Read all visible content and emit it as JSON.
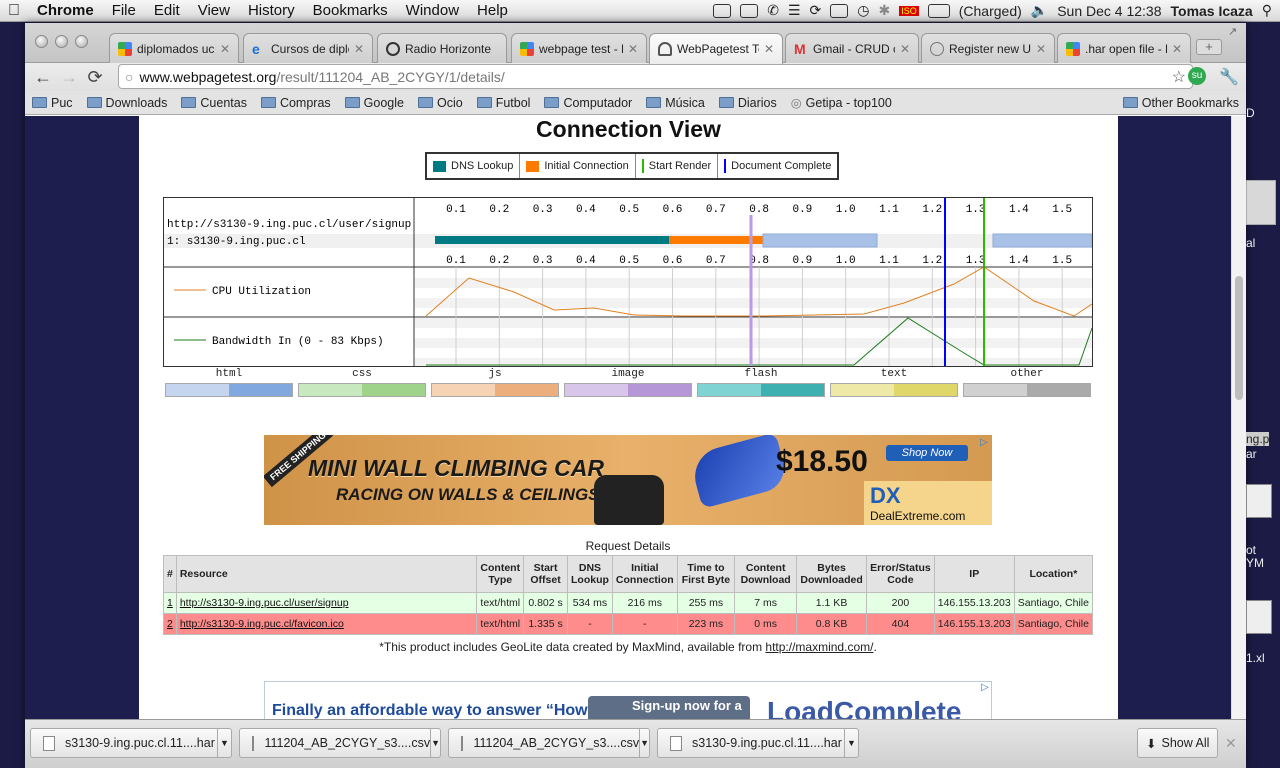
{
  "menubar": {
    "app": "Chrome",
    "items": [
      "File",
      "Edit",
      "View",
      "History",
      "Bookmarks",
      "Window",
      "Help"
    ],
    "battery": "(Charged)",
    "datetime": "Sun Dec 4  12:38",
    "user": "Tomas Icaza"
  },
  "tabs": [
    {
      "label": "diplomados uc",
      "favicon": "google"
    },
    {
      "label": "Cursos de diplom",
      "favicon": "ie"
    },
    {
      "label": "Radio Horizonte",
      "favicon": "radio"
    },
    {
      "label": "webpage test - E",
      "favicon": "google"
    },
    {
      "label": "WebPagetest Tes",
      "favicon": "speedometer",
      "active": true
    },
    {
      "label": "Gmail - CRUD co",
      "favicon": "gmail"
    },
    {
      "label": "Register new Use",
      "favicon": "globe"
    },
    {
      "label": ".har open file - E",
      "favicon": "google"
    }
  ],
  "url": {
    "host": "www.webpagetest.org",
    "path": "/result/111204_AB_2CYGY/1/details/"
  },
  "bookmarks": [
    "Puc",
    "Downloads",
    "Cuentas",
    "Compras",
    "Google",
    "Ocio",
    "Futbol",
    "Computador",
    "Música",
    "Diarios"
  ],
  "bookmark_getipa": "Getipa - top100",
  "bookmark_other": "Other Bookmarks",
  "page": {
    "title": "Connection View",
    "legend": {
      "dns": "DNS Lookup",
      "initial": "Initial Connection",
      "start_render": "Start Render",
      "doc_complete": "Document Complete"
    },
    "colors": {
      "dns": "#007b84",
      "initial": "#ff7b00",
      "start_render": "#28bc00",
      "doc_complete": "#0000ff",
      "bar": "#a9c1e6"
    },
    "waterfall": {
      "url": "http://s3130-9.ing.puc.cl/user/signup",
      "host_row": "1: s3130-9.ing.puc.cl",
      "ticks": [
        "0.1",
        "0.2",
        "0.3",
        "0.4",
        "0.5",
        "0.6",
        "0.7",
        "0.8",
        "0.9",
        "1.0",
        "1.1",
        "1.2",
        "1.3",
        "1.4",
        "1.5"
      ],
      "cpu_label": "CPU Utilization",
      "bw_label": "Bandwidth In (0 - 83 Kbps)"
    },
    "content_types": [
      "html",
      "css",
      "js",
      "image",
      "flash",
      "text",
      "other"
    ],
    "content_colors": [
      [
        "#c6d5ef",
        "#82a8e0"
      ],
      [
        "#c8e9bf",
        "#9fd28b"
      ],
      [
        "#f6d3b5",
        "#ebae7c"
      ],
      [
        "#d7c6ea",
        "#b597d8"
      ],
      [
        "#7fd3d3",
        "#3fb0b0"
      ],
      [
        "#eee9a6",
        "#dfd76a"
      ],
      [
        "#d0d0d0",
        "#aaaaaa"
      ]
    ],
    "ad1": {
      "badge": "FREE SHIPPING",
      "headline": "MINI WALL CLIMBING CAR",
      "subline": "RACING ON WALLS & CEILINGS!",
      "price": "$18.50",
      "cta": "Shop Now",
      "brand": "DealExtreme.com"
    },
    "request_details": {
      "title": "Request Details",
      "columns": [
        "#",
        "Resource",
        "Content Type",
        "Start Offset",
        "DNS Lookup",
        "Initial Connection",
        "Time to First Byte",
        "Content Download",
        "Bytes Downloaded",
        "Error/Status Code",
        "IP",
        "Location*"
      ],
      "rows": [
        [
          "1",
          "http://s3130-9.ing.puc.cl/user/signup",
          "text/html",
          "0.802 s",
          "534 ms",
          "216 ms",
          "255 ms",
          "7 ms",
          "1.1 KB",
          "200",
          "146.155.13.203",
          "Santiago, Chile"
        ],
        [
          "2",
          "http://s3130-9.ing.puc.cl/favicon.ico",
          "text/html",
          "1.335 s",
          "-",
          "-",
          "223 ms",
          "0 ms",
          "0.8 KB",
          "404",
          "146.155.13.203",
          "Santiago, Chile"
        ]
      ],
      "note_prefix": "*This product includes GeoLite data created by MaxMind, available from ",
      "note_link": "http://maxmind.com/",
      "note_suffix": "."
    },
    "ad2": {
      "headline": "Finally an affordable way to answer “How",
      "cta": "Sign-up now for a",
      "brand": "LoadComplete"
    }
  },
  "downloads": [
    "s3130-9.ing.puc.cl.11....har",
    "111204_AB_2CYGY_s3....csv",
    "111204_AB_2CYGY_s3....csv",
    "s3130-9.ing.puc.cl.11....har"
  ],
  "show_all": "Show All",
  "desktop": [
    "D",
    "al",
    "ng.p",
    "ar",
    "ot",
    "YM",
    "1.xl"
  ]
}
